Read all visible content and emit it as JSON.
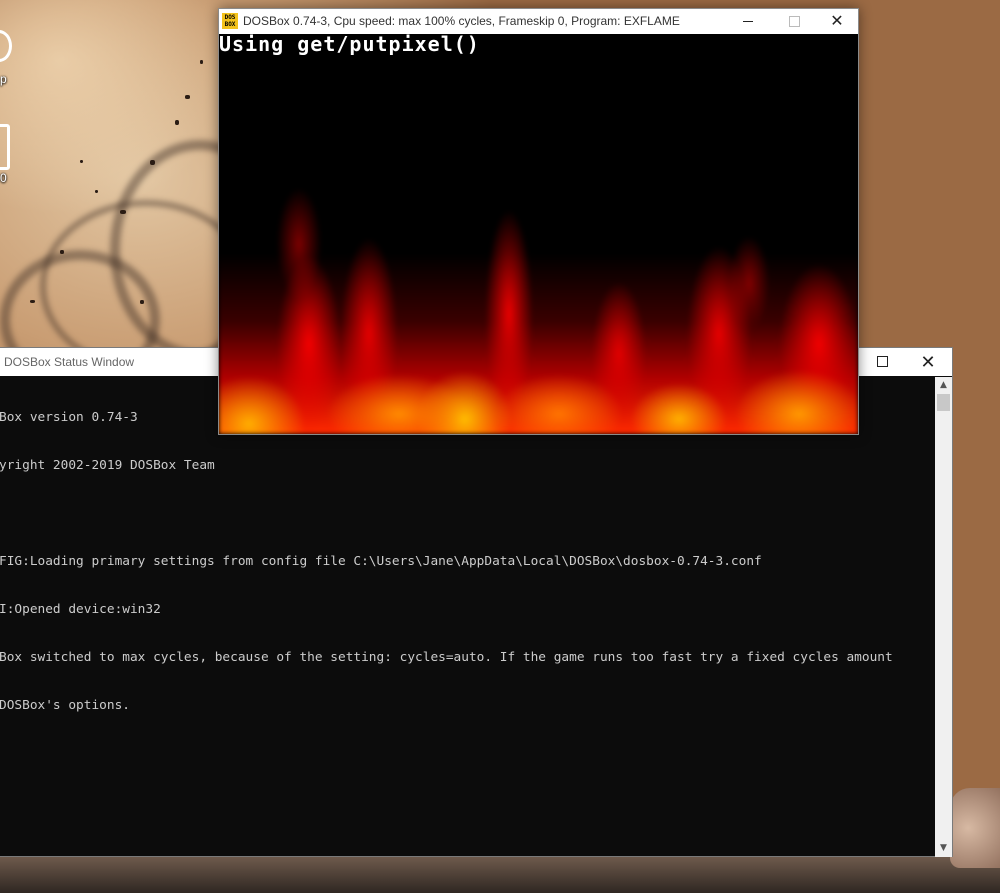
{
  "desktop": {
    "icon1_label": "p",
    "icon2_label": "0"
  },
  "status_window": {
    "title": "DOSBox Status Window",
    "close_glyph": "✕",
    "scroll_up_glyph": "▲",
    "scroll_down_glyph": "▼",
    "lines": [
      "Box version 0.74-3",
      "yright 2002-2019 DOSBox Team",
      "",
      "FIG:Loading primary settings from config file C:\\Users\\Jane\\AppData\\Local\\DOSBox\\dosbox-0.74-3.conf",
      "I:Opened device:win32",
      "Box switched to max cycles, because of the setting: cycles=auto. If the game runs too fast try a fixed cycles amount",
      "DOSBox's options."
    ]
  },
  "dosbox_window": {
    "icon_text": "DOS BOX",
    "title": "DOSBox 0.74-3, Cpu speed: max 100% cycles, Frameskip  0, Program:  EXFLAME",
    "close_glyph": "✕",
    "screen_caption": "Using get/putpixel()"
  },
  "colors": {
    "console_bg": "#0c0c0c",
    "console_text": "#cccccc",
    "titlebar_bg": "#ffffff",
    "fire_hot": "#ffb000",
    "fire_red": "#e00000"
  }
}
